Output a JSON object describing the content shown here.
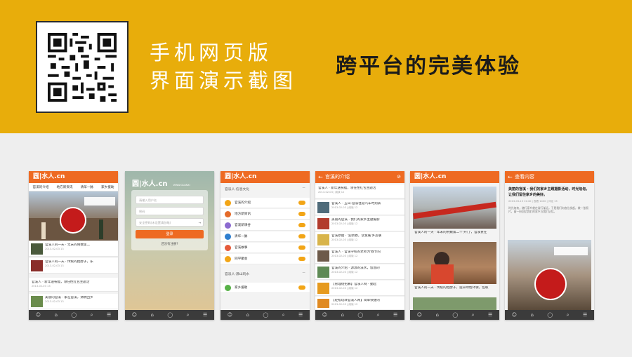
{
  "banner": {
    "title_line1": "手机网页版",
    "title_line2": "界面演示截图",
    "tagline": "跨平台的完美体验",
    "bg_color": "#e8ad0b",
    "qr_icon": "qr-code-icon"
  },
  "colors": {
    "accent": "#ee6a22",
    "bottom_bar": "#3b3b3b",
    "background": "#eeeeee"
  },
  "bottom_nav": [
    "☺",
    "⌂",
    "◯",
    "⌕",
    "☰"
  ],
  "phones": {
    "home": {
      "logo": "圆|水人.cn",
      "tabs": [
        "官溪的介绍",
        "地方新资讯",
        "清华一脉",
        "家乡援助"
      ],
      "rows": [
        {
          "title": "官溪人的一天 · 年末的例数第二",
          "meta": "2013-02-03 13"
        },
        {
          "title": "官溪人的一天 · 传统的抬醇子，乐",
          "meta": "2013-02-03 13"
        },
        {
          "title": "官溪人 · 新年送祝福，领任性红包主题活",
          "meta": "2013-02-03 13"
        },
        {
          "title": "美丽的官溪 · 家在官溪，清明回乡",
          "meta": "2013-02-03 13"
        }
      ]
    },
    "login": {
      "logo": "圆|水人.cn",
      "logo_sub": "WWW.GUANXI",
      "username_placeholder": "请输入用户名",
      "password_placeholder": "密码",
      "code_placeholder": "安全密码(未设置请忽略)",
      "login_button": "登录",
      "register_link": "还没有注册?"
    },
    "menu": {
      "logo": "圆|水人.cn",
      "section1": "官溪人·信息文化",
      "items": [
        {
          "label": "官溪的介绍",
          "color": "#f2a516"
        },
        {
          "label": "地方新资讯",
          "color": "#e46b2a"
        },
        {
          "label": "官溪新课谷",
          "color": "#8c6bd0"
        },
        {
          "label": "清华一脉",
          "color": "#2f7fcf"
        },
        {
          "label": "官溪故事",
          "color": "#e55a3a"
        },
        {
          "label": "同学聚会",
          "color": "#f2a516"
        }
      ],
      "section2": "官溪人·源山玩水",
      "items2": [
        {
          "label": "家乡援助",
          "color": "#57b147"
        }
      ]
    },
    "list": {
      "header": "官溪的介绍",
      "rows": [
        {
          "title": "官溪人 · 新年送祝福，领任性红包主题活",
          "meta": "2013-02-03 | 阅读 12"
        },
        {
          "title": "官溪人 · 玉山-官溪往返汽车时刻表",
          "meta": "2013-02-03 | 阅读 12"
        },
        {
          "title": "美丽的官溪 · 我们的家乡主题摄影",
          "meta": "2013-02-03 | 阅读 12"
        },
        {
          "title": "官溪原腊 · '迎新春，读发展'乡友联",
          "meta": "2013-02-03 | 阅读 12"
        },
        {
          "title": "官溪人 · 官溪学校的老师为'春节的",
          "meta": "2013-02-03 | 阅读 12"
        },
        {
          "title": "官溪的介绍 · 源源的溪水，悠悠的",
          "meta": "2013-02-03 | 阅读 12"
        },
        {
          "title": "【管理组招募】官溪人网 · 勤起",
          "meta": "2013-02-03 | 阅读 12"
        },
        {
          "title": "【轻松玩转官溪人网】简单快捷的",
          "meta": "2013-02-03 | 阅读 12"
        }
      ]
    },
    "album": {
      "logo": "圆|水人.cn",
      "captions": [
        "官溪人的一天 · 年末的例数第二个'开门'，官溪县在",
        "官溪人的一天 · 传统的抬醇子，提升绿色环保，包取"
      ]
    },
    "detail": {
      "header": "查看内容",
      "title": "美丽的官溪 · 我们的家乡主题摄影活动，时光匆匆，让我们留住家乡的美好。",
      "meta": "2013-03-13 12:40 | 查看 1400 | 评论 15",
      "body": "时光匆匆，随行家乡就在渐行渐远，于是我们向各位发起，做一张照片，留一份回忆我们的家乡与我们记忆。"
    }
  }
}
